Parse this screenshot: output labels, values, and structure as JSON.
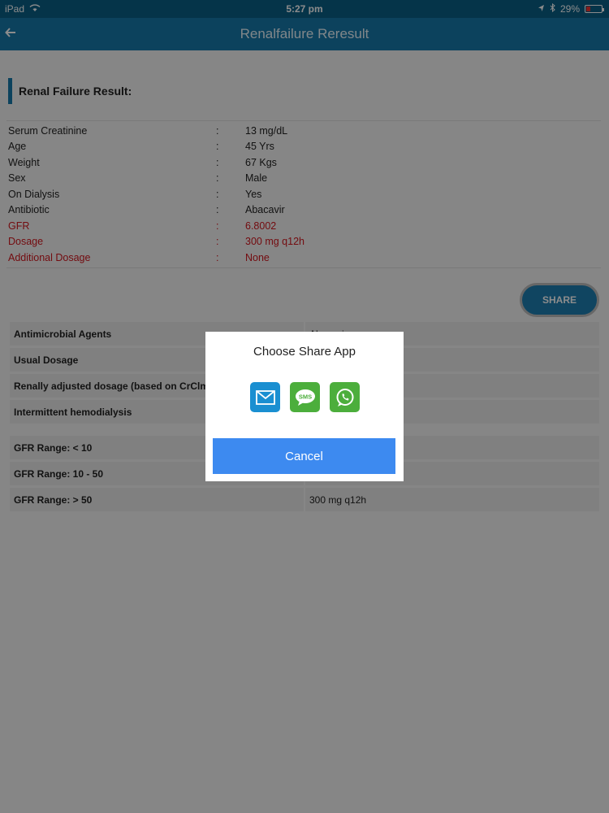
{
  "status_bar": {
    "device": "iPad",
    "time": "5:27 pm",
    "battery": "29%",
    "battery_level": 0.29
  },
  "app_bar": {
    "title": "Renalfailure Reresult"
  },
  "result": {
    "heading": "Renal Failure Result:",
    "separator": ":",
    "rows": [
      {
        "label": "Serum Creatinine",
        "value": "13 mg/dL"
      },
      {
        "label": "Age",
        "value": "45 Yrs"
      },
      {
        "label": "Weight",
        "value": "67 Kgs"
      },
      {
        "label": "Sex",
        "value": "Male"
      },
      {
        "label": "On Dialysis",
        "value": "Yes"
      },
      {
        "label": "Antibiotic",
        "value": "Abacavir"
      },
      {
        "label": "GFR",
        "value": "6.8002"
      },
      {
        "label": "Dosage",
        "value": "300 mg q12h"
      },
      {
        "label": "Additional Dosage",
        "value": "None"
      }
    ]
  },
  "share_button": "SHARE",
  "drug_table": [
    {
      "label": "Antimicrobial Agents",
      "value": "Abacavir"
    },
    {
      "label": "Usual Dosage",
      "value": ""
    },
    {
      "label": "Renally adjusted dosage (based on CrClml/min)",
      "value": ""
    },
    {
      "label": "Intermittent hemodialysis",
      "value": ""
    }
  ],
  "gfr_table": [
    {
      "label": "GFR Range: < 10",
      "value": ""
    },
    {
      "label": "GFR Range: 10 - 50",
      "value": ""
    },
    {
      "label": "GFR Range: > 50",
      "value": "300 mg q12h"
    }
  ],
  "dialog": {
    "title": "Choose Share App",
    "apps": [
      "mail-icon",
      "sms-icon",
      "whatsapp-icon"
    ],
    "sms_label": "SMS",
    "cancel": "Cancel"
  },
  "colors": {
    "primary": "#1679aa",
    "danger": "#d2161e",
    "cancel": "#3d8af0"
  }
}
